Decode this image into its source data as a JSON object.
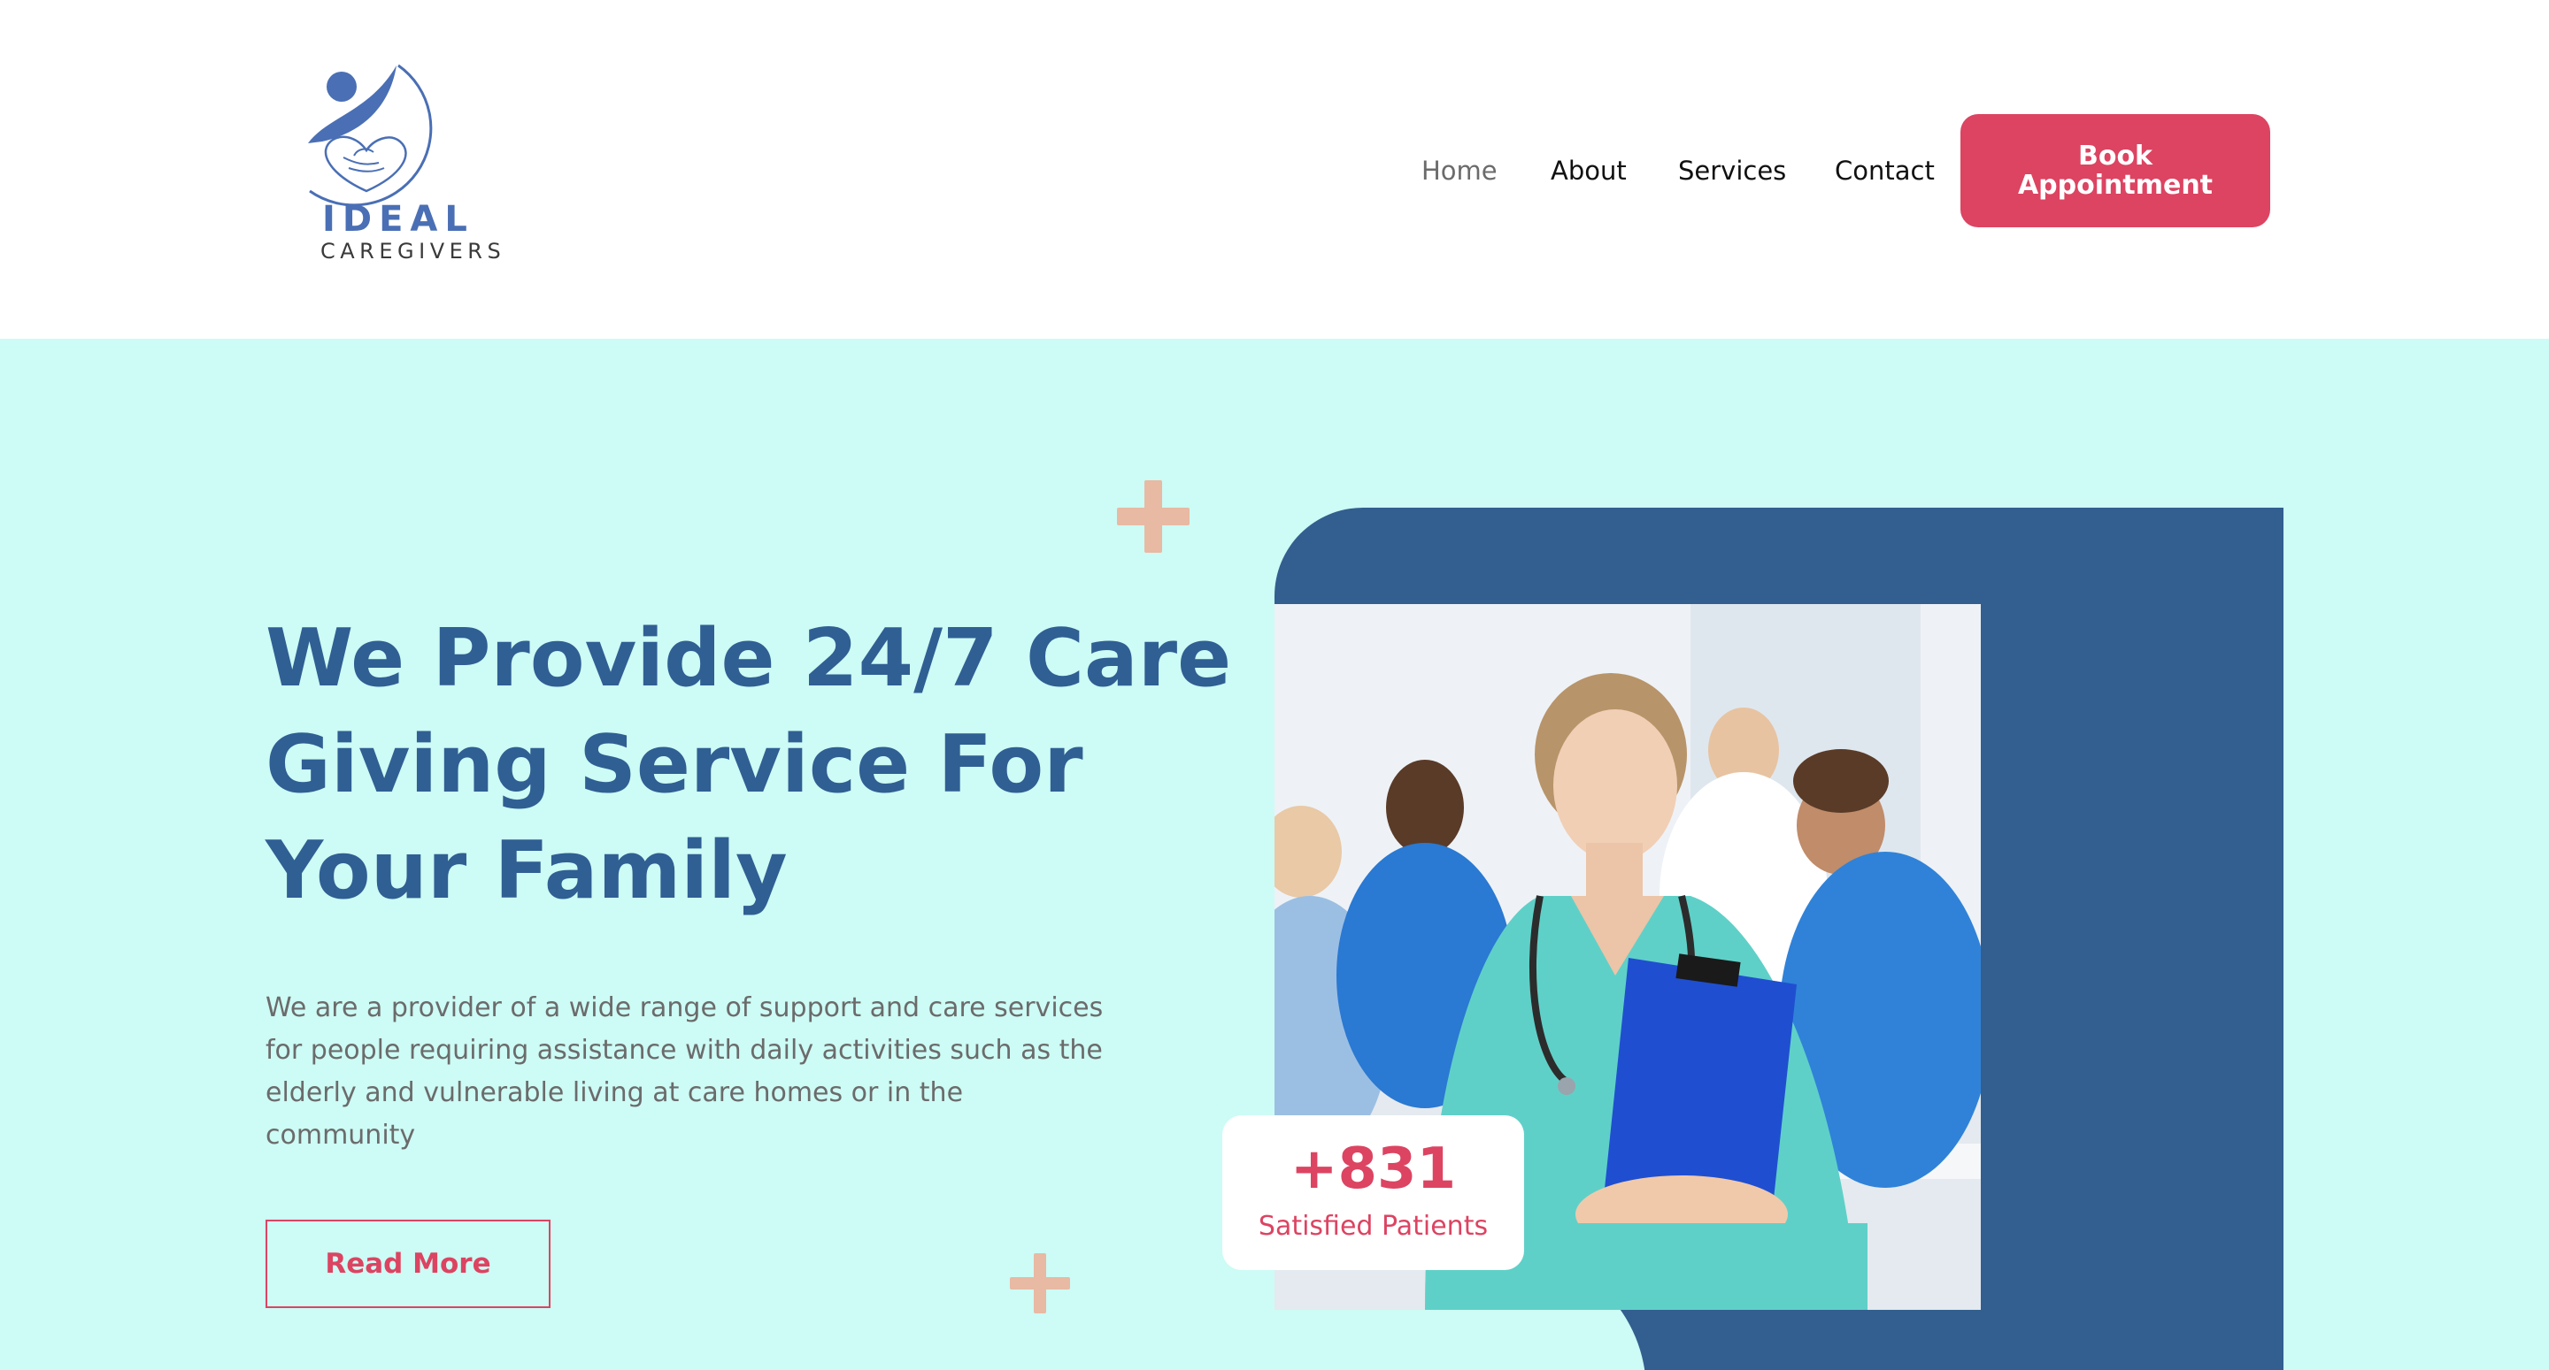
{
  "brand": {
    "name": "IDEAL",
    "tagline": "CAREGIVERS",
    "primary_color": "#325f8f",
    "accent_color": "#dc4462",
    "hero_background": "#cdfbf5"
  },
  "nav": {
    "items": [
      {
        "label": "Home",
        "active": true
      },
      {
        "label": "About",
        "active": false
      },
      {
        "label": "Services",
        "active": false
      },
      {
        "label": "Contact",
        "active": false
      }
    ],
    "cta_label": "Book Appointment"
  },
  "hero": {
    "title": "We Provide 24/7 Care Giving Service For Your Family",
    "description": "We are a provider of a wide range of support and care services for people requiring assistance with daily activities such as the elderly and vulnerable living at care homes or in the community",
    "read_more_label": "Read More",
    "image_icon": "nurse-holding-clipboard-photo",
    "decor_icon": "plus-icon"
  },
  "stat": {
    "value": "+831",
    "label": "Satisfied Patients"
  }
}
